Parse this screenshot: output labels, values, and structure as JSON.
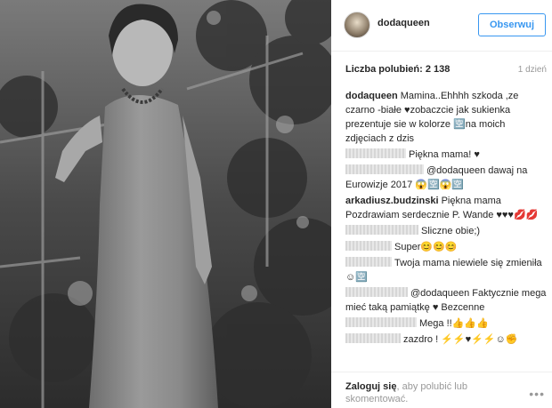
{
  "post": {
    "username": "dodaqueen",
    "follow_label": "Obserwuj",
    "likes": "Liczba polubień: 2 138",
    "time_ago": "1 dzień"
  },
  "comments": [
    {
      "user": "dodaqueen",
      "text": "Mamina..Ehhhh szkoda ,ze czarno -białe ♥zobaczcie jak sukienka prezentuje sie w kolorze 🈳na moich zdjęciach z dzis",
      "redacted": false
    },
    {
      "user": "",
      "text": "Piękna mama! ♥",
      "redacted": true
    },
    {
      "user": "",
      "text": "@dodaqueen dawaj na Eurowizje 2017 😱🈳😱🈳",
      "redacted": true
    },
    {
      "user": "arkadiusz.budzinski",
      "text": "Piękna mama Pozdrawiam serdecznie P. Wande ♥♥♥💋💋",
      "redacted": false
    },
    {
      "user": "",
      "text": "Sliczne obie;)",
      "redacted": true
    },
    {
      "user": "",
      "text": "Super😊😊😊",
      "redacted": true
    },
    {
      "user": "",
      "text": "Twoja mama niewiele się zmieniła ☺🈳",
      "redacted": true
    },
    {
      "user": "",
      "text": "@dodaqueen Faktycznie mega mieć taką pamiątkę ♥ Bezcenne",
      "redacted": true
    },
    {
      "user": "",
      "text": "Mega !!👍👍👍",
      "redacted": true
    },
    {
      "user": "",
      "text": "zazdro ! ⚡⚡♥⚡⚡☺✊",
      "redacted": true
    }
  ],
  "footer": {
    "login_link": "Zaloguj się",
    "login_rest": ", aby polubić lub skomentować.",
    "more_icon": "more-options-icon"
  }
}
